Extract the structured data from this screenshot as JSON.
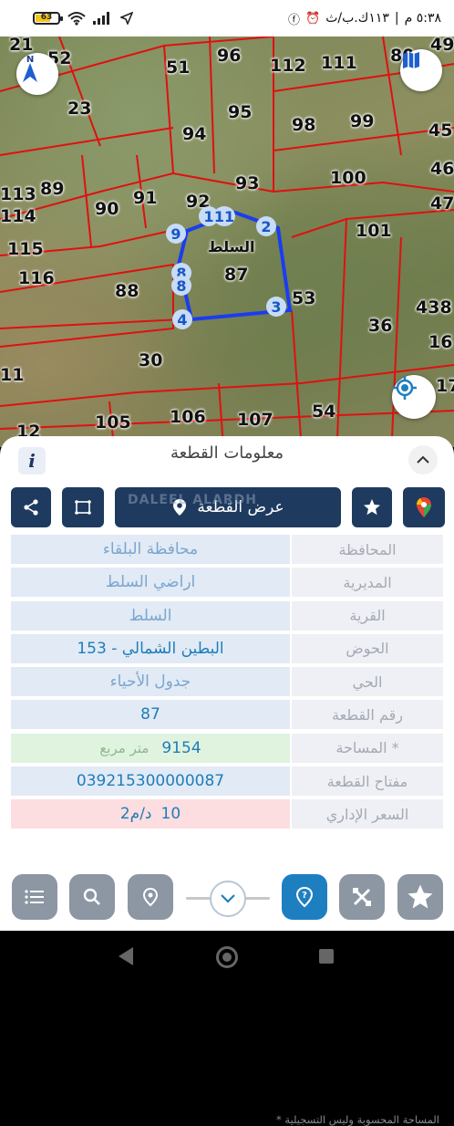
{
  "status": {
    "battery": "63",
    "time_text": "٥:٣٨ م",
    "carrier_text": "١١٣ك.ب/ث"
  },
  "map": {
    "selected_area_name": "السلط",
    "parcels": [
      "21",
      "52",
      "51",
      "96",
      "112",
      "111",
      "80",
      "49",
      "23",
      "95",
      "98",
      "99",
      "45",
      "94",
      "46",
      "113",
      "89",
      "93",
      "100",
      "47",
      "114",
      "90",
      "91",
      "92",
      "101",
      "115",
      "116",
      "87",
      "88",
      "53",
      "438",
      "36",
      "16",
      "30",
      "17",
      "11",
      "12",
      "105",
      "106",
      "107",
      "54"
    ],
    "vertex_labels": [
      "1",
      "11",
      "2",
      "9",
      "8",
      "8",
      "4",
      "3"
    ],
    "compass_label": "N",
    "colors": {
      "parcel_lines": "#e01010",
      "selection": "#1a3df0"
    }
  },
  "sheet": {
    "title": "معلومات القطعة",
    "show_parcel_label": "عرض القطعة",
    "watermark": "DALEEL ALARDH",
    "rows": [
      {
        "key": "المحافظة",
        "value": "محافظة البلقاء"
      },
      {
        "key": "المديرية",
        "value": "اراضي السلط"
      },
      {
        "key": "القرية",
        "value": "السلط"
      },
      {
        "key": "الحوض",
        "value": "البطين الشمالي - 153"
      },
      {
        "key": "الحي",
        "value": "جدول الأحياء"
      },
      {
        "key": "رقم القطعة",
        "value": "87"
      },
      {
        "key": "المساحة *",
        "value": "9154",
        "unit": "متر مربع"
      },
      {
        "key": "مفتاح القطعة",
        "value": "039215300000087"
      },
      {
        "key": "السعر الإداري",
        "value": "10",
        "unit": "د/م2"
      }
    ],
    "footnote": "* المساحة المحسوبة وليس التسجيلية"
  },
  "colors": {
    "primary": "#1e3a5f",
    "accent": "#1e7fc0",
    "value_bg": "#e1eaf5",
    "area_bg": "#dff3df",
    "price_bg": "#fcdde0"
  }
}
